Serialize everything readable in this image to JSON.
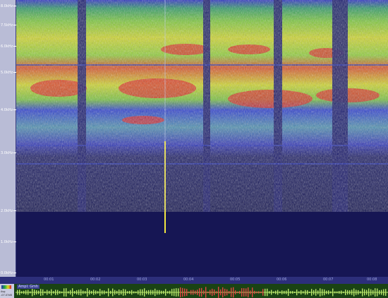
{
  "frequency_axis": {
    "ticks": [
      "8.0kHz",
      "7.5kHz",
      "6.0kHz",
      "5.0kHz",
      "4.0kHz",
      "3.0kHz",
      "2.0kHz",
      "1.0kHz",
      "0.0kHz"
    ]
  },
  "time_axis": {
    "ticks": [
      "00:01",
      "00:02",
      "00:03",
      "00:04",
      "00:05",
      "00:06",
      "00:07",
      "00:08"
    ]
  },
  "waveform": {
    "channel_label": "Ampl: Gmh",
    "left_label_top": "Avg",
    "left_label_bottom": "-07.07dB"
  },
  "colors": {
    "background": "#161654",
    "low": "#3a3ad0",
    "mid": "#2fb35a",
    "high": "#d8e32a",
    "peak": "#e02424",
    "waveform_bg": "#1a4314",
    "waveform_line": "#b9e66a",
    "waveform_highlight": "#e04444"
  }
}
